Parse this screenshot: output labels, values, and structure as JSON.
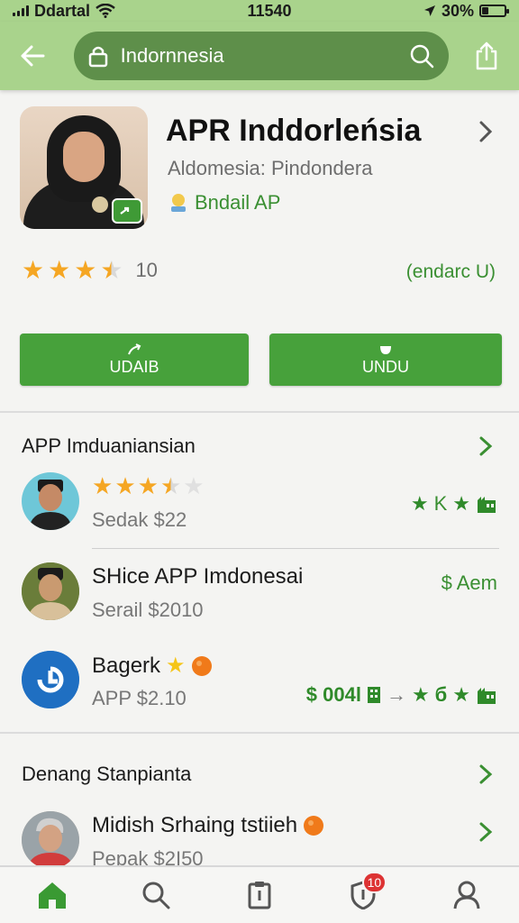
{
  "status_bar": {
    "carrier": "Ddartal",
    "time": "11540",
    "battery": "30%",
    "battery_level": 0.3
  },
  "search": {
    "value": "Indornnesia"
  },
  "app": {
    "title": "APR Inddorleńsia",
    "subtitle": "Aldomesia: Pindondera",
    "badge": "Bndail AP",
    "rating_value": 3.5,
    "rating_count": "10",
    "rating_right": "(endarc U)"
  },
  "buttons": {
    "primary_label": "UDAIB",
    "secondary_label": "UNDU"
  },
  "section1": {
    "title": "APP Imduaniansian",
    "items": [
      {
        "rating_value": 3.5,
        "subtitle": "Sedak $22",
        "right": "K"
      },
      {
        "title": "SHice APP Imdonesai",
        "subtitle": "Serail $2010",
        "right": "$ Aem"
      },
      {
        "title": "Bagerk",
        "subtitle": "APP  $2.10",
        "right_prefix": "$ 004l",
        "right_mid": "б"
      }
    ]
  },
  "section2": {
    "title": "Denang Stanpianta",
    "items": [
      {
        "title": "Midish Srhaing tstiieh",
        "subtitle": "Pepak $2I50"
      }
    ]
  },
  "bottom_nav": {
    "notif_count": "10"
  },
  "colors": {
    "header": "#a9d38c",
    "search_bg": "#5e8f4a",
    "accent": "#47a13b",
    "star": "#f5a623"
  }
}
